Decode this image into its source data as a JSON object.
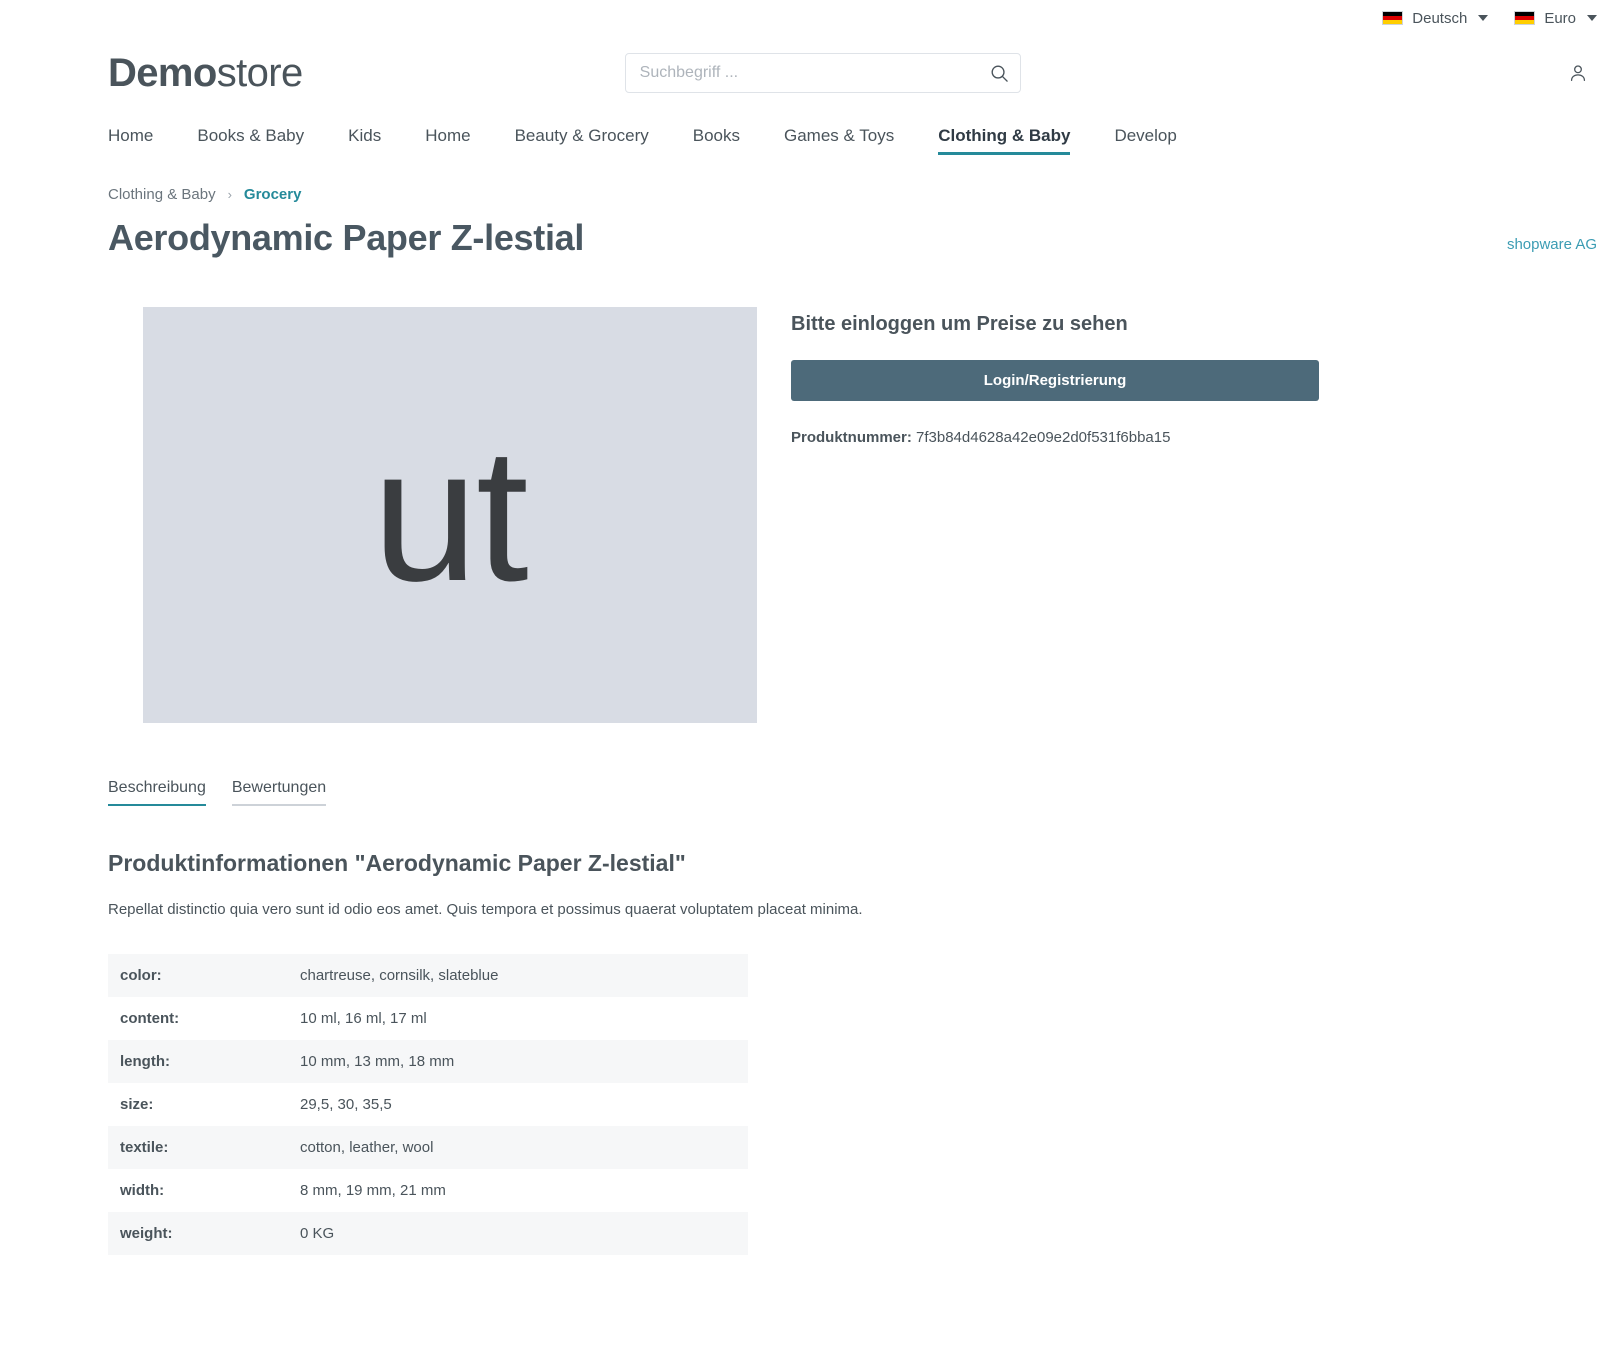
{
  "topbar": {
    "language": {
      "label": "Deutsch",
      "flag_icon": "german-flag-icon"
    },
    "currency": {
      "label": "Euro",
      "flag_icon": "german-flag-icon"
    }
  },
  "header": {
    "logo_bold": "Demo",
    "logo_regular": "store",
    "search": {
      "placeholder": "Suchbegriff ...",
      "value": "",
      "icon": "search-icon"
    },
    "account_icon": "user-account-icon"
  },
  "nav": {
    "items": [
      {
        "label": "Home",
        "active": false
      },
      {
        "label": "Books & Baby",
        "active": false
      },
      {
        "label": "Kids",
        "active": false
      },
      {
        "label": "Home",
        "active": false
      },
      {
        "label": "Beauty & Grocery",
        "active": false
      },
      {
        "label": "Books",
        "active": false
      },
      {
        "label": "Games & Toys",
        "active": false
      },
      {
        "label": "Clothing & Baby",
        "active": true
      },
      {
        "label": "Develop",
        "active": false
      }
    ]
  },
  "breadcrumb": {
    "parent": "Clothing & Baby",
    "separator": "›",
    "current": "Grocery"
  },
  "product": {
    "title": "Aerodynamic Paper Z-lestial",
    "manufacturer": "shopware AG",
    "image_placeholder_text": "ut",
    "number_label": "Produktnummer:",
    "number_value": "7f3b84d4628a42e09e2d0f531f6bba15"
  },
  "buy_box": {
    "heading": "Bitte einloggen um Preise zu sehen",
    "login_button": "Login/Registrierung"
  },
  "tabs": [
    {
      "label": "Beschreibung",
      "active": true
    },
    {
      "label": "Bewertungen",
      "active": false
    }
  ],
  "description": {
    "heading": "Produktinformationen \"Aerodynamic Paper Z-lestial\"",
    "text": "Repellat distinctio quia vero sunt id odio eos amet. Quis tempora et possimus quaerat voluptatem placeat minima."
  },
  "properties": [
    {
      "label": "color:",
      "value": "chartreuse, cornsilk, slateblue"
    },
    {
      "label": "content:",
      "value": "10 ml, 16 ml, 17 ml"
    },
    {
      "label": "length:",
      "value": "10 mm, 13 mm, 18 mm"
    },
    {
      "label": "size:",
      "value": "29,5, 30, 35,5"
    },
    {
      "label": "textile:",
      "value": "cotton, leather, wool"
    },
    {
      "label": "width:",
      "value": "8 mm, 19 mm, 21 mm"
    },
    {
      "label": "weight:",
      "value": "0 KG"
    }
  ],
  "colors": {
    "accent": "#258a9a",
    "link": "#3b9cb3",
    "button": "#4d6a7a",
    "text": "#4a545b",
    "placeholder_bg": "#d8dce4"
  }
}
